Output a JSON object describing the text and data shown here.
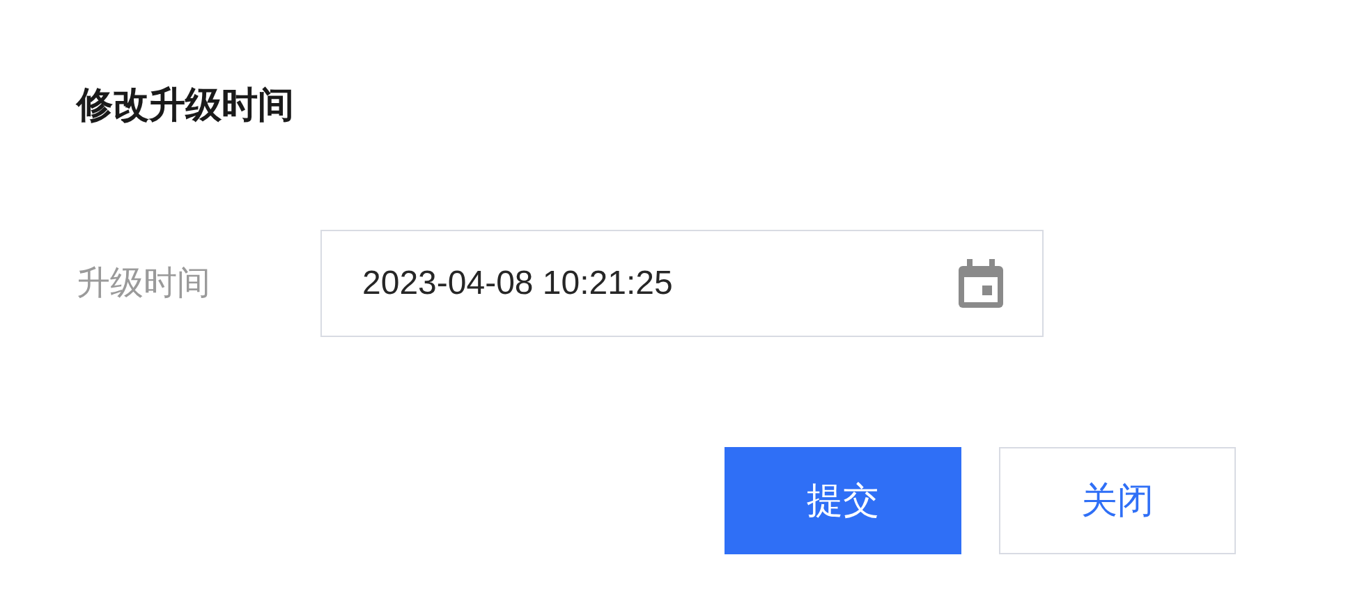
{
  "dialog": {
    "title": "修改升级时间"
  },
  "field": {
    "label": "升级时间",
    "value": "2023-04-08 10:21:25"
  },
  "buttons": [
    {
      "label": "提交",
      "kind": "primary"
    },
    {
      "label": "关闭",
      "kind": "secondary"
    }
  ]
}
